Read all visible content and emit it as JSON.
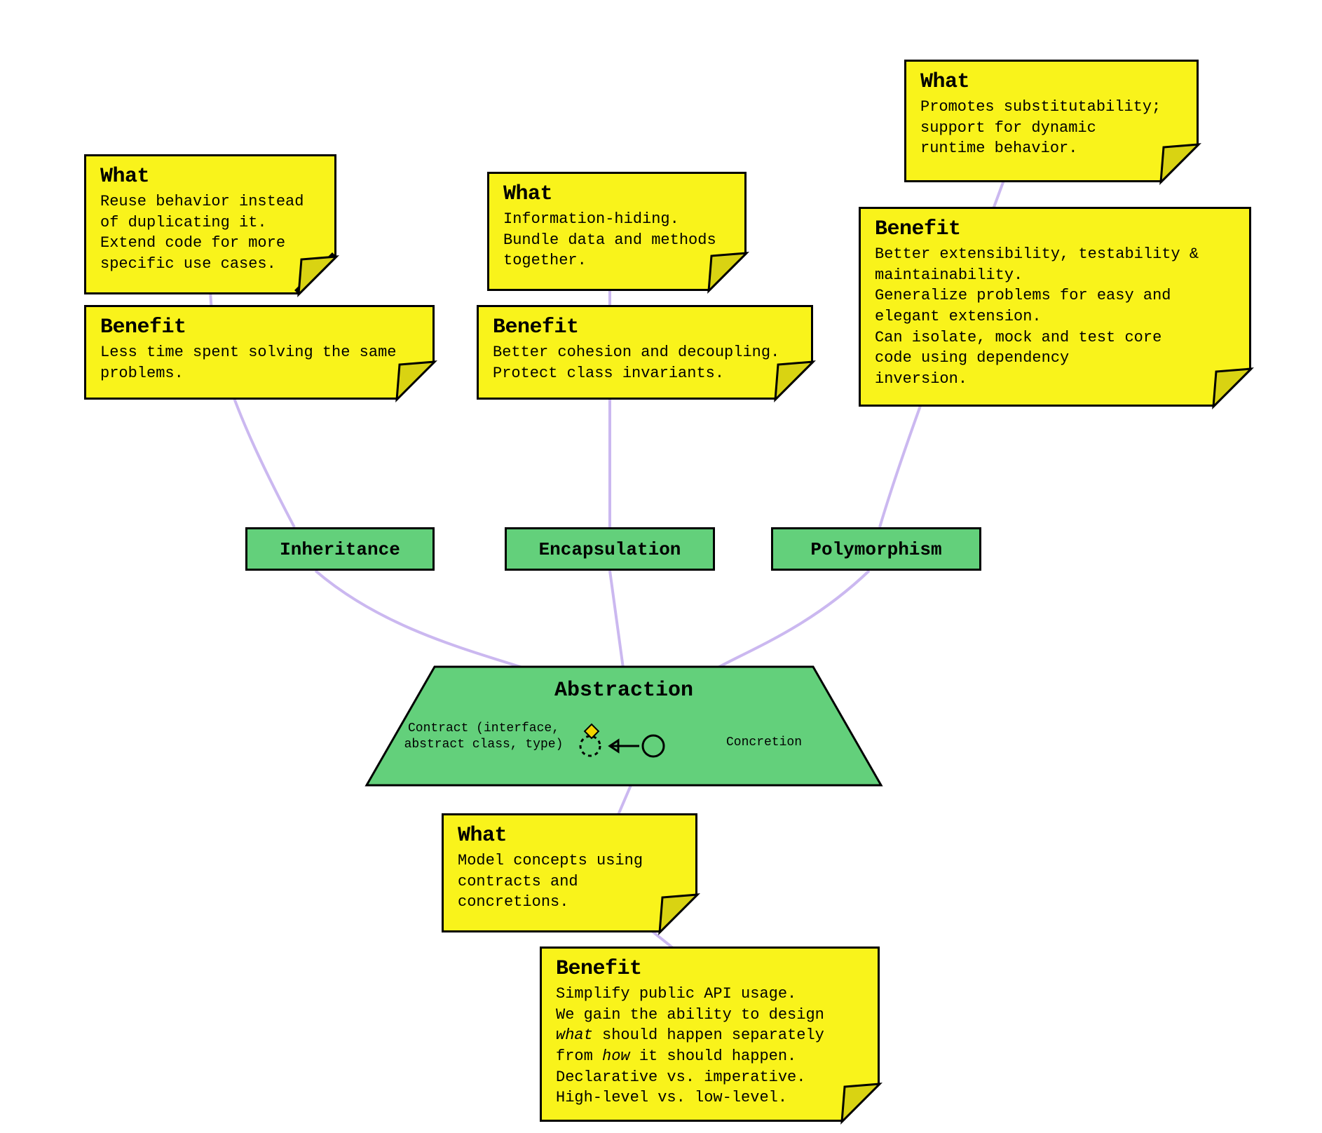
{
  "pillars": {
    "inheritance": {
      "label": "Inheritance",
      "what_title": "What",
      "what_body": "Reuse behavior instead\nof duplicating it.\nExtend code for more\nspecific use cases.",
      "benefit_title": "Benefit",
      "benefit_body": "Less time spent solving the same\nproblems."
    },
    "encapsulation": {
      "label": "Encapsulation",
      "what_title": "What",
      "what_body": "Information-hiding.\nBundle data and methods\ntogether.",
      "benefit_title": "Benefit",
      "benefit_body": "Better cohesion and decoupling.\nProtect class invariants."
    },
    "polymorphism": {
      "label": "Polymorphism",
      "what_title": "What",
      "what_body": "Promotes substitutability;\nsupport for dynamic\nruntime behavior.",
      "benefit_title": "Benefit",
      "benefit_body": "Better extensibility, testability &\nmaintainability.\nGeneralize problems for easy and\nelegant extension.\nCan isolate, mock and test core\ncode using dependency\ninversion."
    }
  },
  "abstraction": {
    "label": "Abstraction",
    "contract_label": "Contract\n(interface,\nabstract class, type)",
    "concretion_label": "Concretion",
    "what_title": "What",
    "what_body": "Model concepts using\ncontracts and\nconcretions.",
    "benefit_title": "Benefit",
    "benefit_body_html": "Simplify public API usage.\nWe gain the ability to design\n<em>what</em> should happen separately\nfrom <em>how</em> it should happen.\nDeclarative vs. imperative.\nHigh-level vs. low-level."
  },
  "colors": {
    "note": "#f9f31b",
    "green": "#63d07b",
    "connector": "#cbb8f0"
  }
}
